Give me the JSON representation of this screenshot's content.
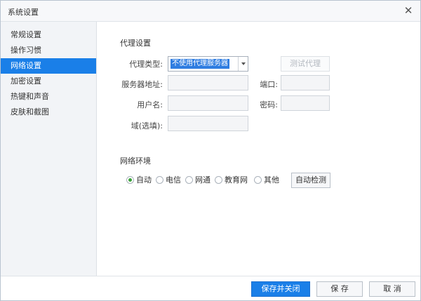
{
  "window": {
    "title": "系统设置",
    "close_label": "✕"
  },
  "sidebar": {
    "items": [
      {
        "label": "常规设置"
      },
      {
        "label": "操作习惯"
      },
      {
        "label": "网络设置"
      },
      {
        "label": "加密设置"
      },
      {
        "label": "热键和声音"
      },
      {
        "label": "皮肤和截图"
      }
    ],
    "active": "网络设置"
  },
  "proxy": {
    "section_title": "代理设置",
    "type_label": "代理类型:",
    "type_value": "不使用代理服务器",
    "test_button": "测试代理",
    "server_label": "服务器地址:",
    "port_label": "端口:",
    "username_label": "用户名:",
    "password_label": "密码:",
    "domain_label": "域(选填):"
  },
  "network": {
    "section_title": "网络环境",
    "options": [
      {
        "label": "自动",
        "checked": true
      },
      {
        "label": "电信",
        "checked": false
      },
      {
        "label": "网通",
        "checked": false
      },
      {
        "label": "教育网",
        "checked": false
      },
      {
        "label": "其他",
        "checked": false
      }
    ],
    "detect_button": "自动检测",
    "checked_color": "#3aa13a"
  },
  "footer": {
    "save_close": "保存并关闭",
    "save": "保 存",
    "cancel": "取 消"
  },
  "colors": {
    "accent": "#1a7fe8"
  }
}
